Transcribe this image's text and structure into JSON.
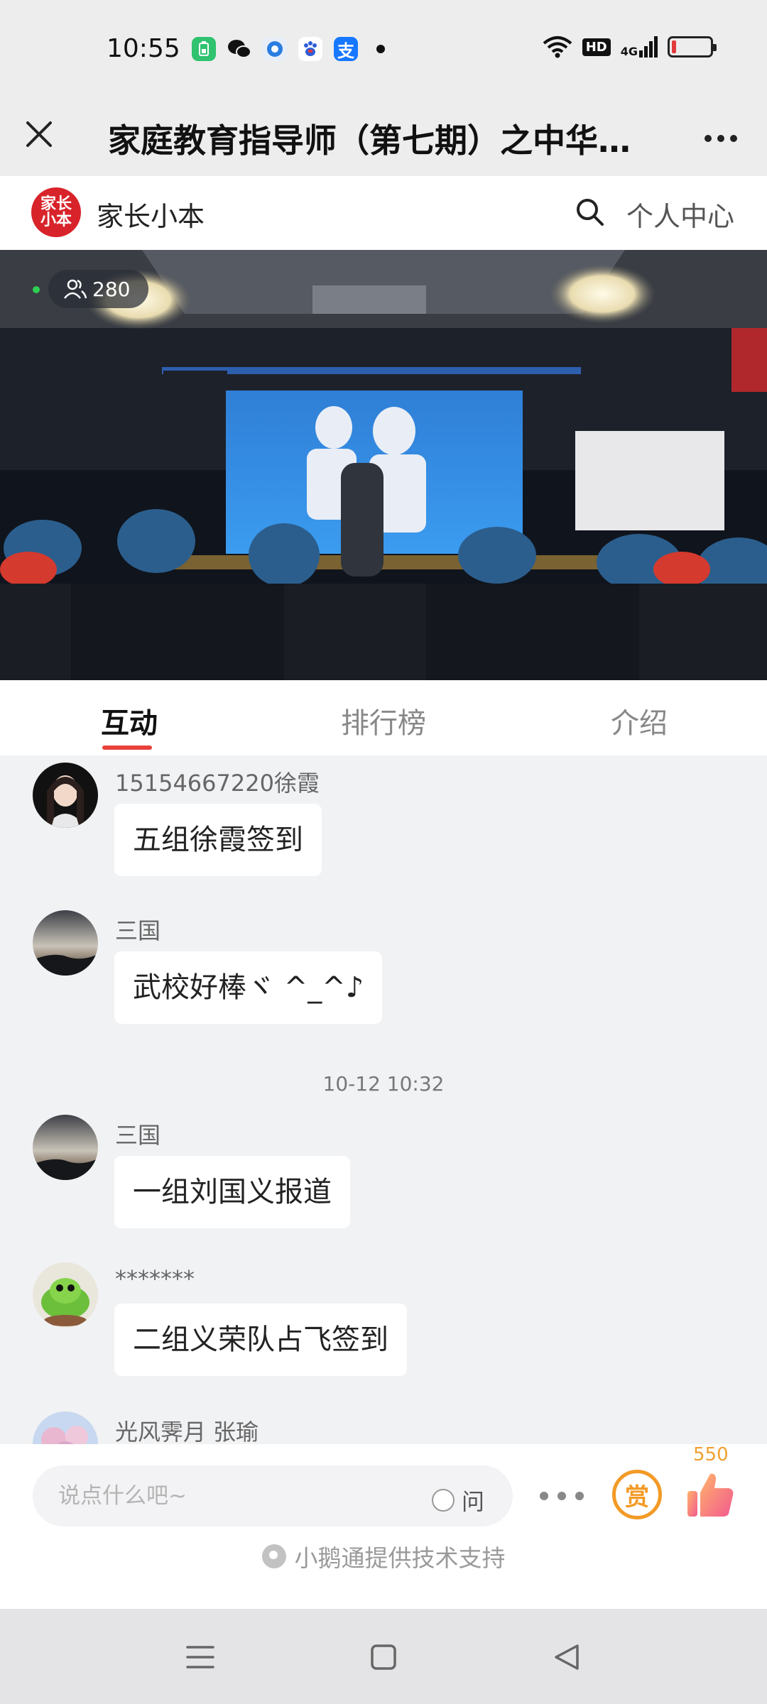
{
  "status_bar": {
    "time": "10:55",
    "network": "4G",
    "hd": "HD",
    "apps": [
      "battery-saver-icon",
      "wechat-icon",
      "browser-icon",
      "baidu-icon",
      "alipay-icon"
    ]
  },
  "title_bar": {
    "title": "家庭教育指导师（第七期）之中华传..."
  },
  "brand": {
    "logo_text": "家长小本",
    "name": "家长小本",
    "personal_center": "个人中心",
    "accent_color": "#d8232a"
  },
  "video": {
    "viewer_count": "280"
  },
  "tabs": [
    {
      "label": "互动",
      "active": true
    },
    {
      "label": "排行榜",
      "active": false
    },
    {
      "label": "介绍",
      "active": false
    }
  ],
  "chat": {
    "messages": [
      {
        "name": "15154667220徐霞",
        "text": "五组徐霞签到"
      },
      {
        "name": "三国",
        "text": "武校好棒ヾ ^_^♪"
      },
      {
        "name": "三国",
        "text": "一组刘国义报道"
      },
      {
        "name": "*******",
        "text": "二组义荣队占飞签到"
      },
      {
        "name": "光风霁月 张瑜",
        "text": ""
      }
    ],
    "timestamp": "10-12 10:32"
  },
  "input": {
    "placeholder": "说点什么吧~",
    "ask_label": "问"
  },
  "actions": {
    "reward_label": "赏",
    "like_count": "550"
  },
  "footer": {
    "tech_support": "小鹅通提供技术支持"
  }
}
